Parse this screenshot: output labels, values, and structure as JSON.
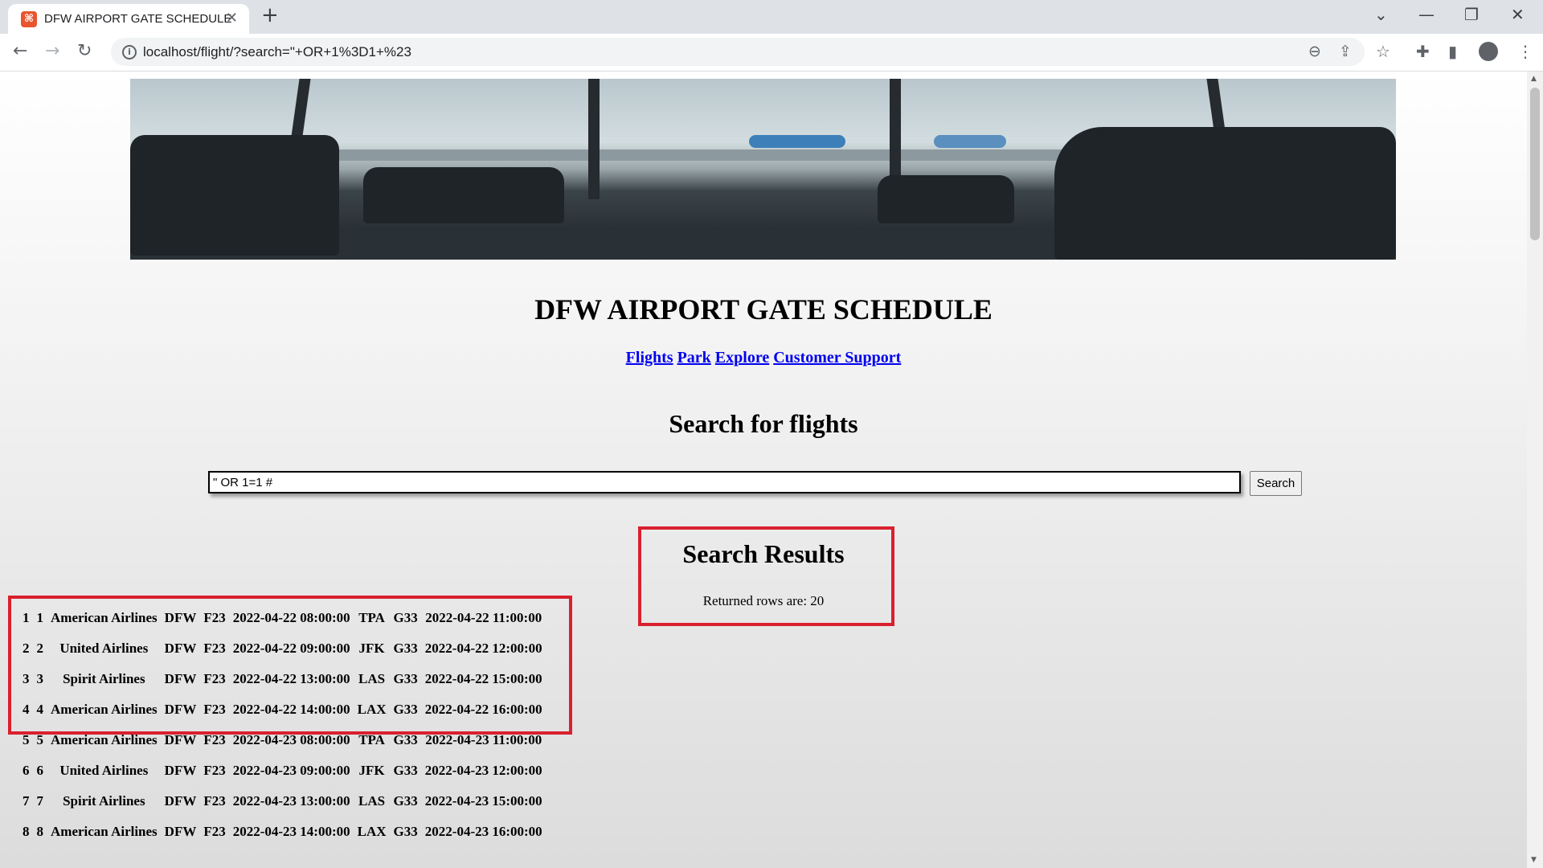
{
  "browser": {
    "tab_title": "DFW AIRPORT GATE SCHEDULE",
    "url": "localhost/flight/?search=\"+OR+1%3D1+%23"
  },
  "page": {
    "title": "DFW AIRPORT GATE SCHEDULE",
    "nav_links": [
      "Flights",
      "Park",
      "Explore",
      "Customer Support"
    ],
    "search_heading": "Search for flights",
    "search_value": "\" OR 1=1 #",
    "search_button": "Search",
    "results_heading": "Search Results",
    "results_count": "Returned rows are: 20"
  },
  "flights": [
    [
      "1",
      "1",
      "American Airlines",
      "DFW",
      "F23",
      "2022-04-22 08:00:00",
      "TPA",
      "G33",
      "2022-04-22 11:00:00"
    ],
    [
      "2",
      "2",
      "United Airlines",
      "DFW",
      "F23",
      "2022-04-22 09:00:00",
      "JFK",
      "G33",
      "2022-04-22 12:00:00"
    ],
    [
      "3",
      "3",
      "Spirit Airlines",
      "DFW",
      "F23",
      "2022-04-22 13:00:00",
      "LAS",
      "G33",
      "2022-04-22 15:00:00"
    ],
    [
      "4",
      "4",
      "American Airlines",
      "DFW",
      "F23",
      "2022-04-22 14:00:00",
      "LAX",
      "G33",
      "2022-04-22 16:00:00"
    ],
    [
      "5",
      "5",
      "American Airlines",
      "DFW",
      "F23",
      "2022-04-23 08:00:00",
      "TPA",
      "G33",
      "2022-04-23 11:00:00"
    ],
    [
      "6",
      "6",
      "United Airlines",
      "DFW",
      "F23",
      "2022-04-23 09:00:00",
      "JFK",
      "G33",
      "2022-04-23 12:00:00"
    ],
    [
      "7",
      "7",
      "Spirit Airlines",
      "DFW",
      "F23",
      "2022-04-23 13:00:00",
      "LAS",
      "G33",
      "2022-04-23 15:00:00"
    ],
    [
      "8",
      "8",
      "American Airlines",
      "DFW",
      "F23",
      "2022-04-23 14:00:00",
      "LAX",
      "G33",
      "2022-04-23 16:00:00"
    ]
  ],
  "icons": {
    "tab_favicon": "xampp-logo-icon",
    "accent_highlight": "#d9202e"
  }
}
